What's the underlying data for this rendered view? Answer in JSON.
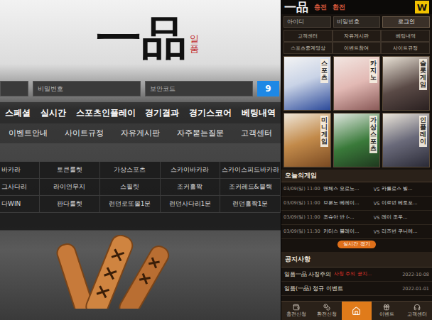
{
  "left": {
    "logo": {
      "main": "一品",
      "sub": "일품"
    },
    "login": {
      "fields": [
        "비밀번호",
        "보안코드"
      ],
      "button": "9"
    },
    "main_nav": [
      "스페셜",
      "실시간",
      "스포츠인플레이",
      "경기결과",
      "경기스코어",
      "베팅내역"
    ],
    "sub_nav": [
      "이벤트안내",
      "사이트규정",
      "자유게시판",
      "자주묻는질문",
      "고객센터"
    ],
    "game_table": {
      "rows": [
        [
          "바카라",
          "토큰룰렛",
          "가상스포츠",
          "스카이바카라",
          "스카이스피드바카라"
        ],
        [
          "그사다리",
          "라이언무지",
          "스필릿",
          "조커홀짝",
          "조커레드&블랙"
        ],
        [
          "다WIN",
          "판다룰렛",
          "런던로또볼1분",
          "런던사다리1분",
          "런던홀짝1분"
        ]
      ]
    }
  },
  "right": {
    "header": {
      "logo": "一品",
      "links": [
        "충전",
        "환전"
      ],
      "badge": "W"
    },
    "login": {
      "fields": [
        "아이디",
        "비밀번호"
      ],
      "button": "로그인"
    },
    "menu": [
      "고객센터",
      "자유게시판",
      "베팅내역",
      "스포츠중계영상",
      "이벤트참여",
      "사이트규정"
    ],
    "tiles": [
      {
        "label": "스포츠"
      },
      {
        "label": "카지노"
      },
      {
        "label": "슬롯게임"
      },
      {
        "label": "미니게임"
      },
      {
        "label": "가상스포츠"
      },
      {
        "label": "인플레이"
      }
    ],
    "today": {
      "title": "오늘의게임",
      "matches": [
        {
          "date": "03/09(일) 11:00",
          "home": "맨체스 오로노…",
          "vs": "VS",
          "away": "카를로스 빌…"
        },
        {
          "date": "03/09(일) 11:00",
          "home": "브룬노 베레이…",
          "vs": "VS",
          "away": "이르번 베토포…"
        },
        {
          "date": "03/09(일) 11:00",
          "home": "조슈아 반 (-…",
          "vs": "VS",
          "away": "레이 조우…"
        },
        {
          "date": "03/09(일) 11:30",
          "home": "커티스 블레이…",
          "vs": "VS",
          "away": "리즈번 쿠니에…"
        }
      ],
      "live_button": "실시간 경기"
    },
    "notices": {
      "title": "공지사항",
      "items": [
        {
          "title": "일품一品 사칭주의",
          "alert": "사칭 주의 공지…",
          "date": "2022-10-08"
        },
        {
          "title": "일품(一品) 정규 이벤트",
          "alert": "",
          "date": "2022-01-01"
        }
      ]
    },
    "bottom_nav": {
      "left": [
        {
          "label": "충전신청",
          "selected": false
        },
        {
          "label": "환전신청",
          "selected": false
        }
      ],
      "home": {
        "selected": true
      },
      "right": [
        {
          "label": "이벤트",
          "selected": false
        },
        {
          "label": "고객센터",
          "selected": false
        }
      ]
    }
  }
}
